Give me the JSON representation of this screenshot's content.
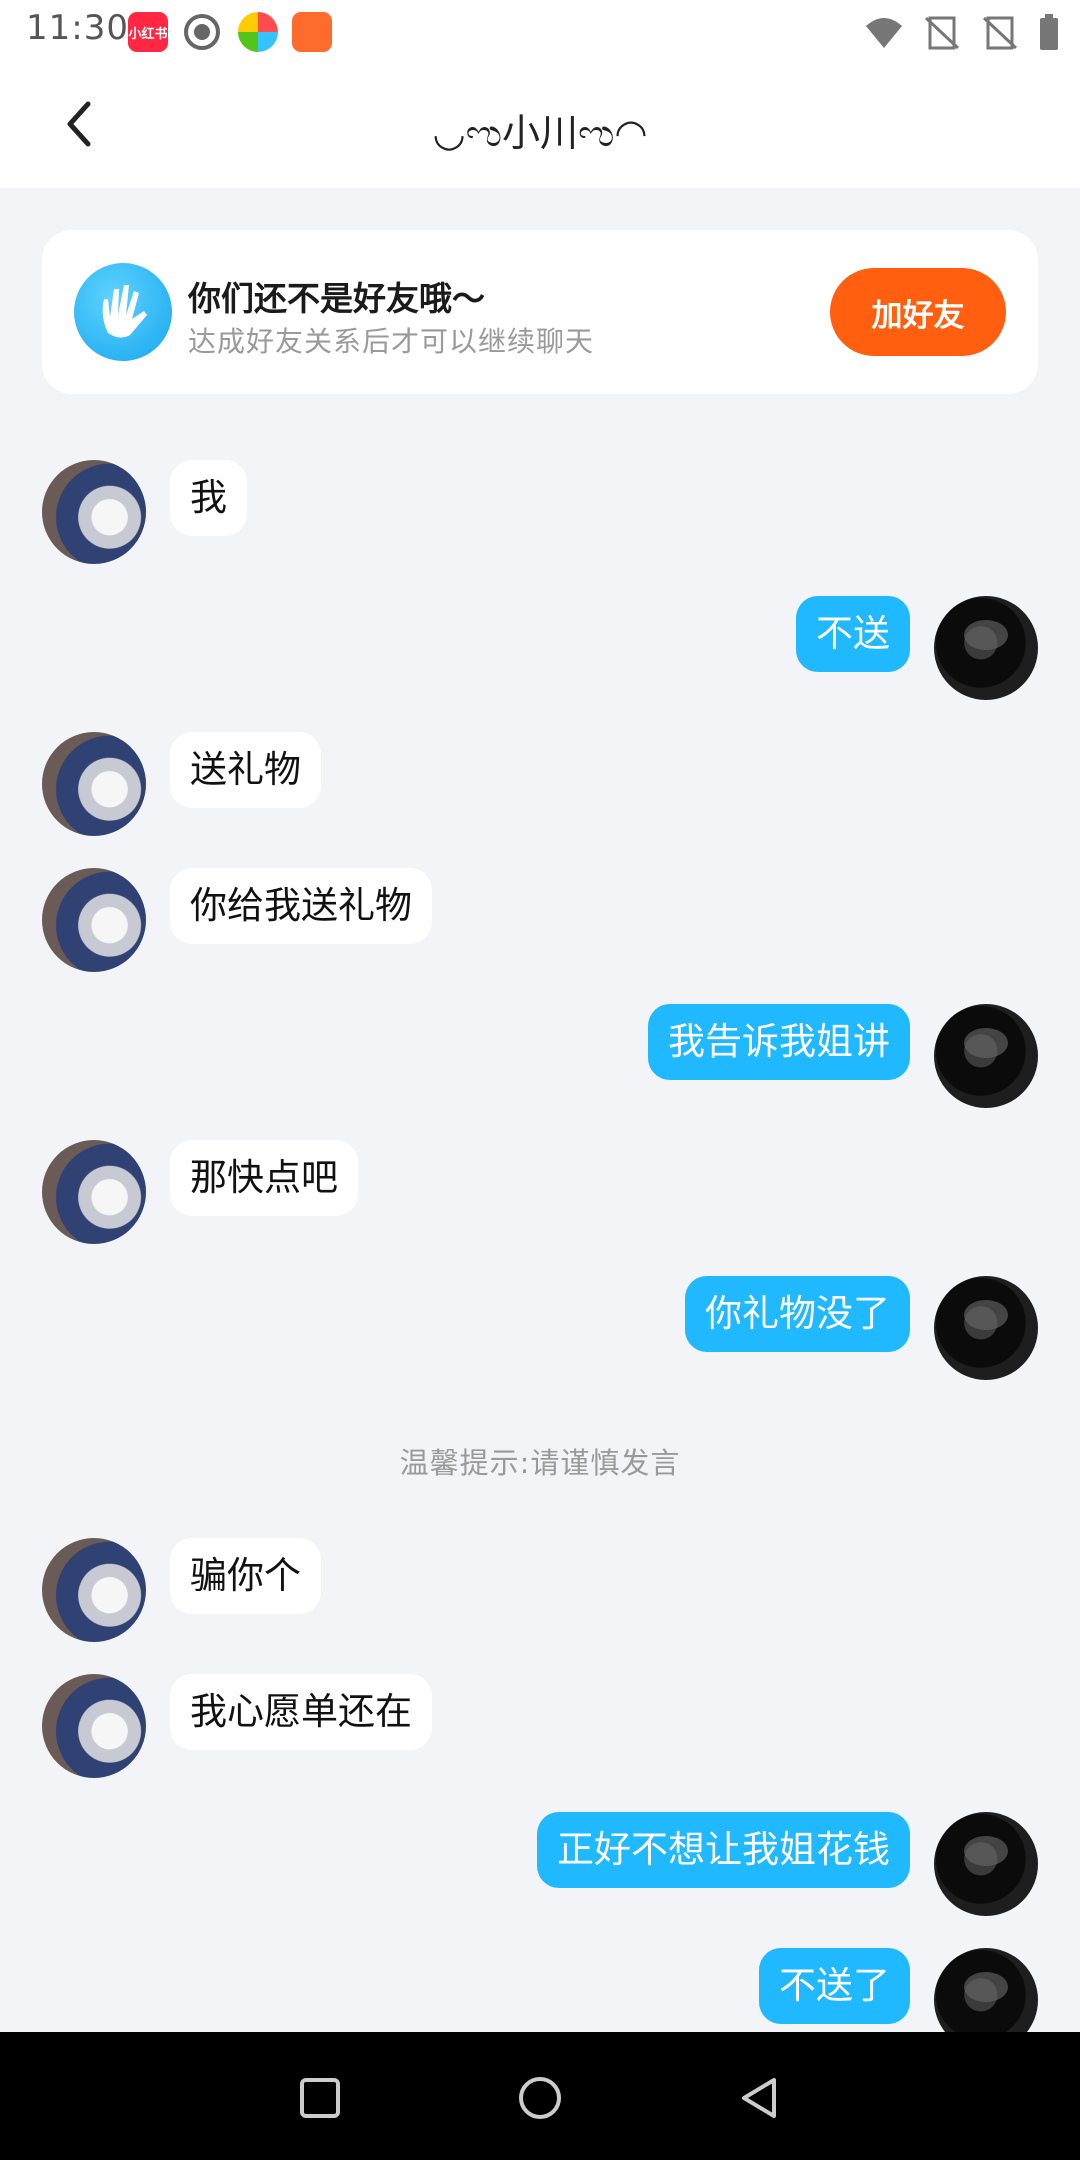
{
  "status": {
    "time": "11:30",
    "apps": [
      {
        "name": "xiaohongshu-icon",
        "label": "小红书"
      },
      {
        "name": "record-icon",
        "label": ""
      },
      {
        "name": "colorful-app-icon",
        "label": ""
      },
      {
        "name": "orange-app-icon",
        "label": ""
      }
    ]
  },
  "header": {
    "title": "◡ಌ小川ಌ◠"
  },
  "friend_card": {
    "title": "你们还不是好友哦～",
    "subtitle": "达成好友关系后才可以继续聊天",
    "add_button": "加好友"
  },
  "messages": [
    {
      "side": "left",
      "text": "我"
    },
    {
      "side": "right",
      "text": "不送"
    },
    {
      "side": "left",
      "text": "送礼物"
    },
    {
      "side": "left",
      "text": "你给我送礼物"
    },
    {
      "side": "right",
      "text": "我告诉我姐讲"
    },
    {
      "side": "left",
      "text": "那快点吧"
    },
    {
      "side": "right",
      "text": "你礼物没了"
    },
    {
      "side": "left",
      "text": "骗你个"
    },
    {
      "side": "left",
      "text": "我心愿单还在"
    },
    {
      "side": "right",
      "text": "正好不想让我姐花钱"
    },
    {
      "side": "right",
      "text": "不送了"
    }
  ],
  "notice": "温馨提示:请谨慎发言",
  "colors": {
    "accent_blue": "#20b8ff",
    "add_button": "#ff5f0f",
    "background": "#f3f4f8"
  }
}
